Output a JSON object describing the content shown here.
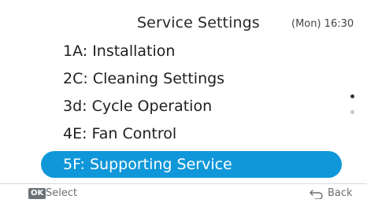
{
  "header": {
    "title": "Service Settings",
    "clock": "(Mon) 16:30"
  },
  "menu": {
    "items": [
      {
        "label": "1A: Installation"
      },
      {
        "label": "2C: Cleaning Settings"
      },
      {
        "label": "3d: Cycle Operation"
      },
      {
        "label": "4E: Fan Control"
      },
      {
        "label": "5F: Supporting Service",
        "selected": true
      }
    ]
  },
  "scroll": {
    "pages": 2,
    "current": 1
  },
  "footer": {
    "ok_badge": "OK",
    "select_label": "Select",
    "back_label": "Back",
    "back_icon": "back-arrow-icon"
  },
  "colors": {
    "selection": "#0f97d9",
    "background": "#ffffff",
    "text": "#222222"
  }
}
